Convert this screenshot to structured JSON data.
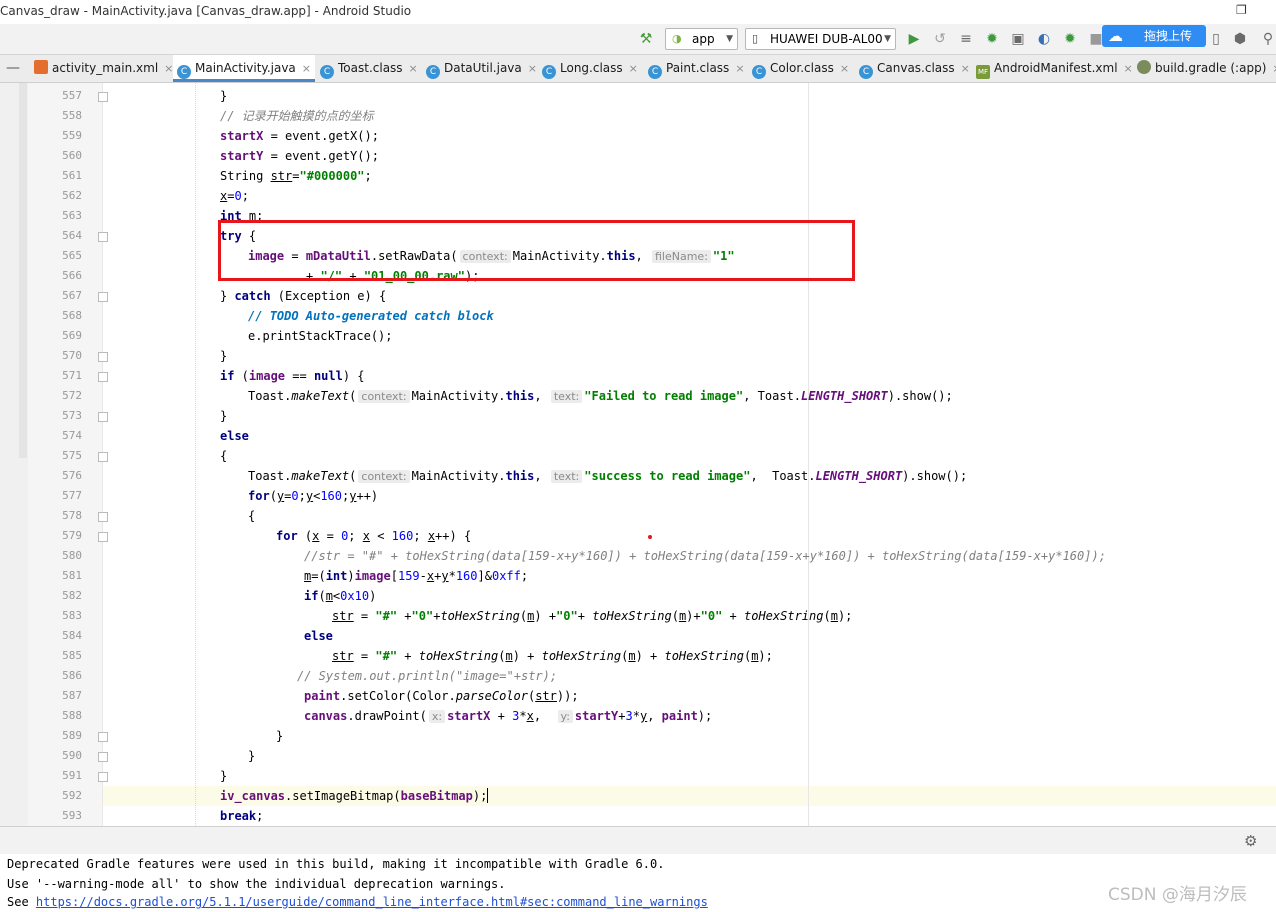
{
  "window": {
    "title": "Canvas_draw - MainActivity.java [Canvas_draw.app] - Android Studio"
  },
  "toolbar": {
    "module_select": "app",
    "device_select": "HUAWEI DUB-AL00",
    "upload_button": "拖拽上传",
    "icons": [
      "hammer-icon",
      "android-icon",
      "phone-icon",
      "run-icon",
      "apply-changes-icon",
      "sync-icon",
      "debug-icon",
      "attach-icon",
      "profile-icon",
      "coverage-icon",
      "stop-icon",
      "cloud-icon",
      "device-manager-icon",
      "sdk-manager-icon",
      "search-icon"
    ]
  },
  "tabs": [
    {
      "label": "activity_main.xml",
      "icon": "xml-file-icon",
      "active": false
    },
    {
      "label": "MainActivity.java",
      "icon": "class-icon",
      "active": true
    },
    {
      "label": "Toast.class",
      "icon": "class-icon",
      "active": false
    },
    {
      "label": "DataUtil.java",
      "icon": "class-icon",
      "active": false
    },
    {
      "label": "Long.class",
      "icon": "class-icon",
      "active": false
    },
    {
      "label": "Paint.class",
      "icon": "class-icon",
      "active": false
    },
    {
      "label": "Color.class",
      "icon": "class-icon",
      "active": false
    },
    {
      "label": "Canvas.class",
      "icon": "class-icon",
      "active": false
    },
    {
      "label": "AndroidManifest.xml",
      "icon": "manifest-icon",
      "active": false
    },
    {
      "label": "build.gradle (:app)",
      "icon": "gradle-icon",
      "active": false
    }
  ],
  "tab_close": "×",
  "editor": {
    "line_numbers": [
      "557",
      "558",
      "559",
      "560",
      "561",
      "562",
      "563",
      "564",
      "565",
      "566",
      "567",
      "568",
      "569",
      "570",
      "571",
      "572",
      "573",
      "574",
      "575",
      "576",
      "577",
      "578",
      "579",
      "580",
      "581",
      "582",
      "583",
      "584",
      "585",
      "586",
      "587",
      "588",
      "589",
      "590",
      "591",
      "592",
      "593"
    ],
    "code": {
      "l557": "}",
      "l558": "// 记录开始触摸的点的坐标",
      "l559a": "startX",
      "l559b": " = event.getX();",
      "l560a": "startY",
      "l560b": " = event.getY();",
      "l561a": "String ",
      "l561b": "str",
      "l561c": "=",
      "l561d": "\"#000000\"",
      "l561e": ";",
      "l562a": "x",
      "l562b": "=",
      "l562c": "0",
      "l562d": ";",
      "l563a": "int",
      "l563b": " m;",
      "l564a": "try",
      "l564b": " {",
      "l565a": "image",
      "l565b": " = ",
      "l565c": "mDataUtil",
      "l565d": ".setRawData(",
      "l565h1": "context:",
      "l565e": "MainActivity.",
      "l565f": "this",
      "l565g": ", ",
      "l565h2": "fileName:",
      "l565i": "\"1\"",
      "l566a": "+ ",
      "l566b": "\"/\"",
      "l566c": " + ",
      "l566d": "\"01_00_00.raw\"",
      "l566e": ");",
      "l567a": "} ",
      "l567b": "catch",
      "l567c": " (Exception e) {",
      "l568a": "// ",
      "l568b": "TODO Auto-generated catch block",
      "l569": "e.printStackTrace();",
      "l570": "}",
      "l571a": "if",
      "l571b": " (",
      "l571c": "image",
      "l571d": " == ",
      "l571e": "null",
      "l571f": ") {",
      "l572a": "Toast.",
      "l572b": "makeText",
      "l572c": "(",
      "l572h1": "context:",
      "l572d": "MainActivity.",
      "l572e": "this",
      "l572f": ", ",
      "l572h2": "text:",
      "l572g": "\"Failed to read image\"",
      "l572i": ", Toast.",
      "l572j": "LENGTH_SHORT",
      "l572k": ").show();",
      "l573": "}",
      "l574": "else",
      "l575": "{",
      "l576a": "Toast.",
      "l576b": "makeText",
      "l576c": "(",
      "l576h1": "context:",
      "l576d": "MainActivity.",
      "l576e": "this",
      "l576f": ", ",
      "l576h2": "text:",
      "l576g": "\"success to read image\"",
      "l576i": ",  Toast.",
      "l576j": "LENGTH_SHORT",
      "l576k": ").show();",
      "l577a": "for",
      "l577b": "(",
      "l577c": "y",
      "l577d": "=",
      "l577e": "0",
      "l577f": ";",
      "l577g": "y",
      "l577h": "<",
      "l577i": "160",
      "l577j": ";",
      "l577k": "y",
      "l577l": "++)",
      "l578": "{",
      "l579a": "for",
      "l579b": " (",
      "l579c": "x",
      "l579d": " = ",
      "l579e": "0",
      "l579f": "; ",
      "l579g": "x",
      "l579h": " < ",
      "l579i": "160",
      "l579j": "; ",
      "l579k": "x",
      "l579l": "++) {",
      "l580": "//str = \"#\" + toHexString(data[159-x+y*160]) + toHexString(data[159-x+y*160]) + toHexString(data[159-x+y*160]);",
      "l581a": "m",
      "l581b": "=(",
      "l581c": "int",
      "l581d": ")",
      "l581e": "image",
      "l581f": "[",
      "l581g": "159",
      "l581h": "-",
      "l581i": "x",
      "l581j": "+",
      "l581k": "y",
      "l581l": "*",
      "l581m": "160",
      "l581n": "]&",
      "l581o": "0xff",
      "l581p": ";",
      "l582a": "if",
      "l582b": "(",
      "l582c": "m",
      "l582d": "<",
      "l582e": "0x10",
      "l582f": ")",
      "l583a": "str",
      "l583b": " = ",
      "l583c": "\"#\"",
      "l583d": " +",
      "l583e": "\"0\"",
      "l583f": "+",
      "l583g": "toHexString",
      "l583h": "(",
      "l583i": "m",
      "l583j": ") +",
      "l583k": "\"0\"",
      "l583l": "+ ",
      "l583m": "toHexString",
      "l583n": "(",
      "l583o": "m",
      "l583p": ")+",
      "l583q": "\"0\"",
      "l583r": " + ",
      "l583s": "toHexString",
      "l583t": "(",
      "l583u": "m",
      "l583v": ");",
      "l584": "else",
      "l585a": "str",
      "l585b": " = ",
      "l585c": "\"#\"",
      "l585d": " + ",
      "l585e": "toHexString",
      "l585f": "(",
      "l585g": "m",
      "l585h": ") + ",
      "l585i": "toHexString",
      "l585j": "(",
      "l585k": "m",
      "l585l": ") + ",
      "l585m": "toHexString",
      "l585n": "(",
      "l585o": "m",
      "l585p": ");",
      "l586": "// System.out.println(\"image=\"+str);",
      "l587a": "paint",
      "l587b": ".setColor(Color.",
      "l587c": "parseColor",
      "l587d": "(",
      "l587e": "str",
      "l587f": "));",
      "l588a": "canvas",
      "l588b": ".drawPoint(",
      "l588h1": "x:",
      "l588c": "startX",
      "l588d": " + ",
      "l588e": "3",
      "l588f": "*",
      "l588g": "x",
      "l588i": ",  ",
      "l588h2": "y:",
      "l588j": "startY",
      "l588k": "+",
      "l588l": "3",
      "l588m": "*",
      "l588n": "y",
      "l588o": ", ",
      "l588p": "paint",
      "l588q": ");",
      "l589": "}",
      "l590": "}",
      "l591": "}",
      "l592a": "iv_canvas",
      "l592b": ".setImageBitmap(",
      "l592c": "baseBitmap",
      "l592d": ");",
      "l593a": "break",
      "l593b": ";"
    }
  },
  "console": {
    "line1": "Deprecated Gradle features were used in this build, making it incompatible with Gradle 6.0.",
    "line2": "Use '--warning-mode all' to show the individual deprecation warnings.",
    "line3_prefix": "See ",
    "line3_link": "https://docs.gradle.org/5.1.1/userguide/command_line_interface.html#sec:command_line_warnings"
  },
  "watermark": "CSDN @海月汐辰",
  "colors": {
    "keyword": "#000080",
    "field": "#660e7a",
    "string": "#008000",
    "number": "#0000ff",
    "comment": "#808080",
    "highlight_box": "#e8161b",
    "accent": "#4a86c8"
  }
}
